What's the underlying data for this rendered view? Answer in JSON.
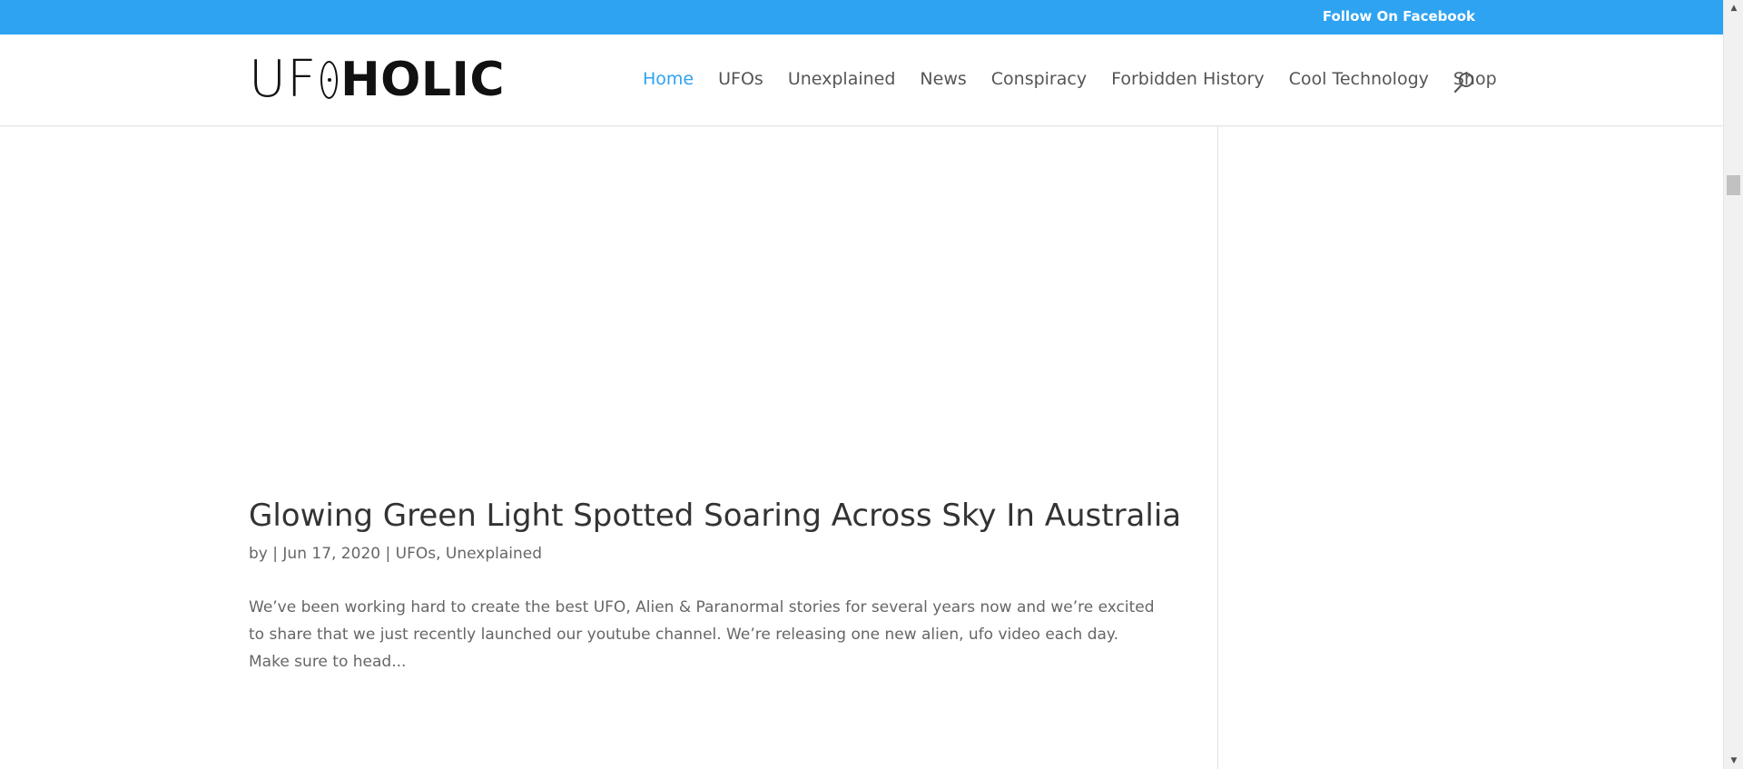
{
  "top_bar": {
    "follow_label": "Follow On Facebook",
    "color": "#2ea3f2"
  },
  "header": {
    "logo": {
      "part_light": "UF",
      "part_bold": "HOLIC",
      "full_text": "UFOHOLIC"
    },
    "nav": [
      {
        "label": "Home",
        "active": true
      },
      {
        "label": "UFOs",
        "active": false
      },
      {
        "label": "Unexplained",
        "active": false
      },
      {
        "label": "News",
        "active": false
      },
      {
        "label": "Conspiracy",
        "active": false
      },
      {
        "label": "Forbidden History",
        "active": false
      },
      {
        "label": "Cool Technology",
        "active": false
      },
      {
        "label": "Shop",
        "active": false
      }
    ],
    "search_icon": "search-icon",
    "accent_color": "#2ea3f2"
  },
  "post": {
    "title": "Glowing Green Light Spotted Soaring Across Sky In Australia",
    "meta": {
      "by": "by",
      "sep1": "|",
      "date": "Jun 17, 2020",
      "sep2": "|",
      "category1": "UFOs",
      "comma": ",",
      "category2": "Unexplained"
    },
    "excerpt": "We’ve been working hard to create the best UFO, Alien & Paranormal stories for several years now and we’re excited to share that we just recently launched our youtube channel. We’re releasing one new alien, ufo video each day. Make sure to head..."
  }
}
